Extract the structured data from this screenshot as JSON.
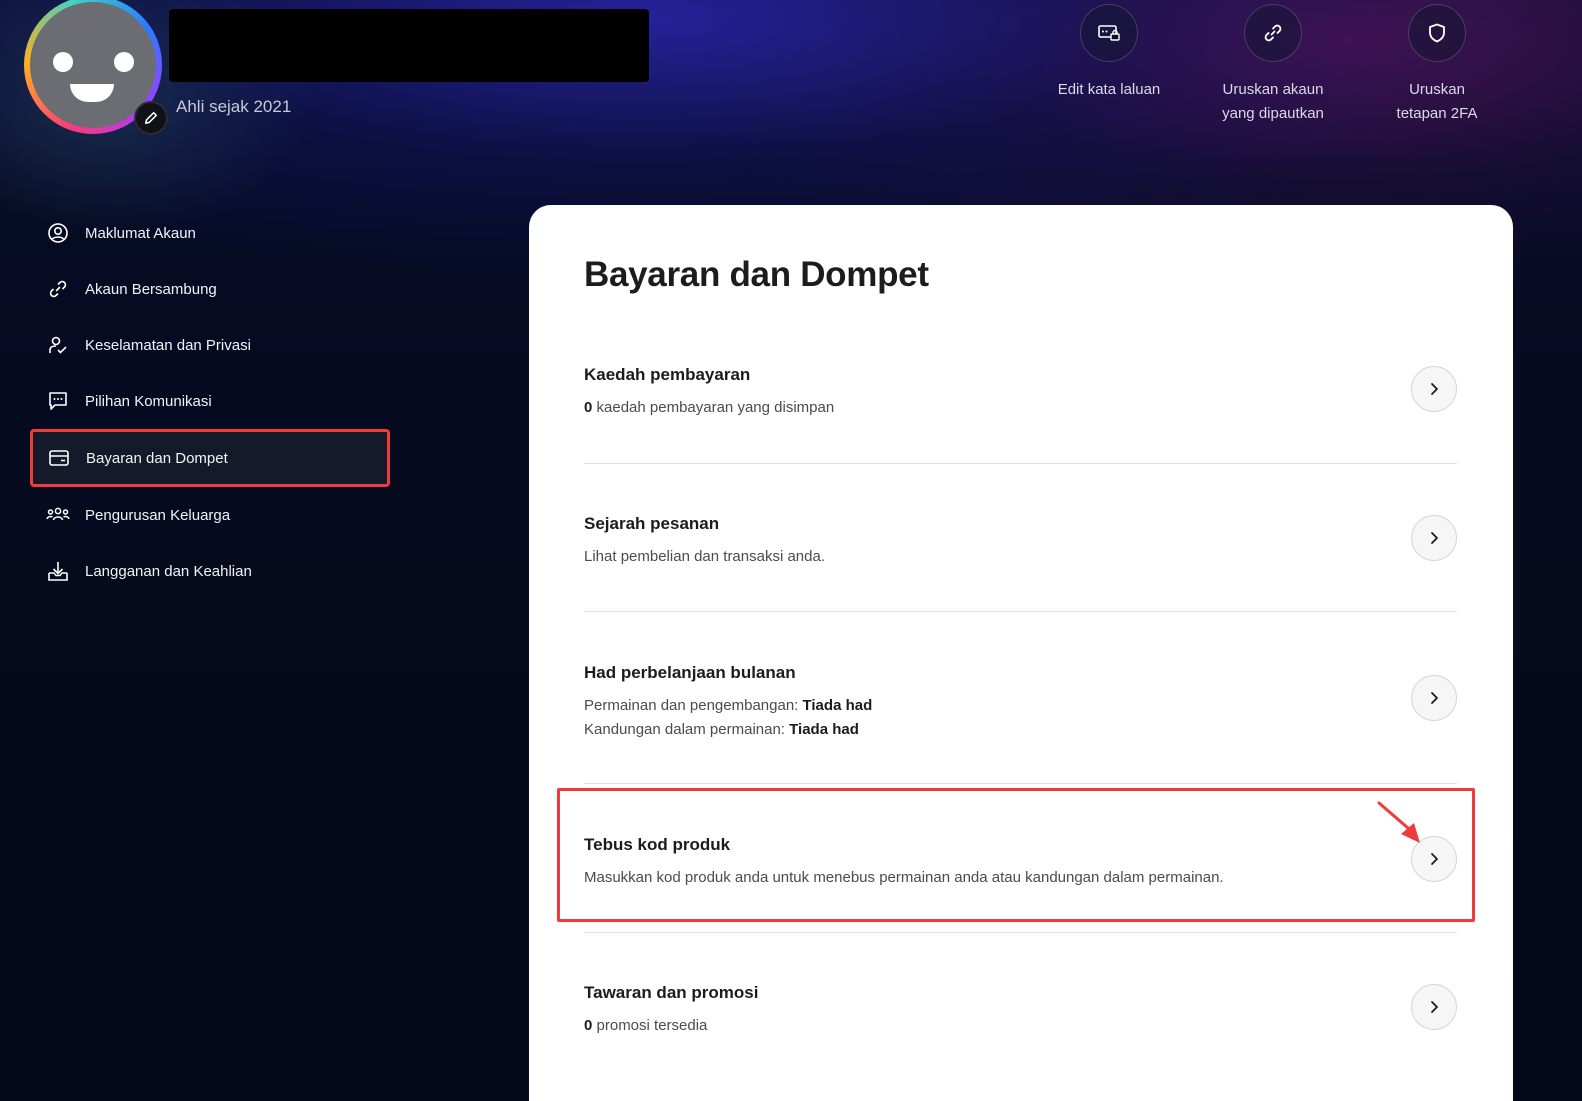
{
  "profile": {
    "member_since": "Ahli sejak 2021"
  },
  "quick_actions": [
    {
      "label_line1": "Edit kata laluan",
      "label_line2": "",
      "icon": "password-lock-icon"
    },
    {
      "label_line1": "Uruskan akaun",
      "label_line2": "yang dipautkan",
      "icon": "link-icon"
    },
    {
      "label_line1": "Uruskan",
      "label_line2": "tetapan 2FA",
      "icon": "shield-icon"
    }
  ],
  "sidebar": {
    "items": [
      {
        "label": "Maklumat Akaun",
        "icon": "user-circle-icon"
      },
      {
        "label": "Akaun Bersambung",
        "icon": "link-icon"
      },
      {
        "label": "Keselamatan dan Privasi",
        "icon": "user-lock-icon"
      },
      {
        "label": "Pilihan Komunikasi",
        "icon": "chat-icon"
      },
      {
        "label": "Bayaran dan Dompet",
        "icon": "wallet-icon",
        "active": true
      },
      {
        "label": "Pengurusan Keluarga",
        "icon": "family-icon"
      },
      {
        "label": "Langganan dan Keahlian",
        "icon": "download-tray-icon"
      }
    ]
  },
  "main": {
    "title": "Bayaran dan Dompet",
    "sections": [
      {
        "title": "Kaedah pembayaran",
        "desc_bold": "0",
        "desc": " kaedah pembayaran yang disimpan"
      },
      {
        "title": "Sejarah pesanan",
        "desc": "Lihat pembelian dan transaksi anda."
      },
      {
        "title": "Had perbelanjaan bulanan",
        "line1_label": "Permainan dan pengembangan: ",
        "line1_value": "Tiada had",
        "line2_label": "Kandungan dalam permainan: ",
        "line2_value": "Tiada had"
      },
      {
        "title": "Tebus kod produk",
        "desc": "Masukkan kod produk anda untuk menebus permainan anda atau kandungan dalam permainan."
      },
      {
        "title": "Tawaran dan promosi",
        "desc_bold": "0",
        "desc": " promosi tersedia"
      }
    ]
  },
  "colors": {
    "highlight": "#ef3b3b",
    "card_bg": "#ffffff",
    "page_bg": "#050a1c"
  }
}
